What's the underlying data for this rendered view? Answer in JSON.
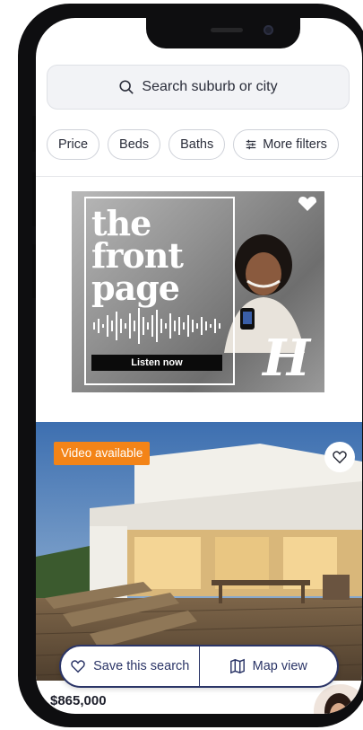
{
  "search": {
    "placeholder": "Search suburb or city"
  },
  "filters": [
    {
      "label": "Price"
    },
    {
      "label": "Beds"
    },
    {
      "label": "Baths"
    },
    {
      "label": "More filters"
    }
  ],
  "ad": {
    "title_line1": "the",
    "title_line2": "front",
    "title_line3": "page",
    "cta": "Listen now",
    "logo_letter": "H"
  },
  "listing": {
    "badge": "Video available",
    "price": "$865,000"
  },
  "actions": {
    "save_label": "Save this search",
    "map_label": "Map view"
  },
  "colors": {
    "accent_navy": "#2b3567",
    "badge_orange": "#f38418"
  }
}
